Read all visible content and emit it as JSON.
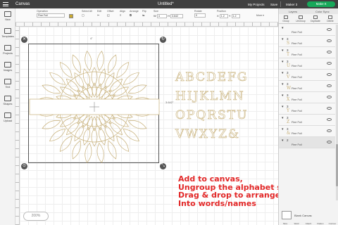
{
  "topbar": {
    "title": "Canvas",
    "document": "Untitled*",
    "my_projects": "My Projects",
    "save": "Save",
    "machine": "Maker 3",
    "make_button": "Make It"
  },
  "left_toolbar": [
    {
      "label": "New",
      "icon": "plus-icon"
    },
    {
      "label": "Templates",
      "icon": "shirt-icon"
    },
    {
      "label": "Projects",
      "icon": "folder-icon"
    },
    {
      "label": "Images",
      "icon": "image-icon"
    },
    {
      "label": "Text",
      "icon": "text-icon"
    },
    {
      "label": "Shapes",
      "icon": "shapes-icon"
    },
    {
      "label": "Upload",
      "icon": "upload-icon"
    }
  ],
  "editbar": {
    "operation_label": "Operation",
    "operation_value": "Fine Foil",
    "select_all": "Select All",
    "edit": "Edit",
    "offset": "Offset",
    "align": "Align",
    "arrange": "Arrange",
    "flip": "Flip",
    "size_label": "Size",
    "width": "4",
    "height": "3.642",
    "rotate_label": "Rotate",
    "rotate": "0",
    "position_label": "Position",
    "x": "1.2",
    "y": "1.2",
    "more": "More ▾",
    "foil_color": "#c9a830"
  },
  "canvas": {
    "width_dim": "4\"",
    "height_dim": "3.642\"",
    "letters_row1": "ABCDEFG",
    "letters_row2": "HIJKLMN",
    "letters_row3": "OPQRSTU",
    "letters_row4": "VWXYZ&",
    "instruction_lines": [
      "Add to canvas,",
      "Ungroup the alphabet set,",
      "Drag & drop to arrange",
      "Into words/names"
    ],
    "zoom": "200%",
    "motif_color": "#c7b079"
  },
  "panel": {
    "tab_layers": "Layers",
    "tab_color_sync": "Color Sync",
    "tools": [
      "Group",
      "UnGroup",
      "Duplicate",
      "Delete"
    ],
    "layers": [
      {
        "count": "",
        "name": "Fine Foil",
        "glyph": ""
      },
      {
        "count": "3",
        "name": "Fine Foil",
        "glyph": "S"
      },
      {
        "count": "3",
        "name": "Fine Foil",
        "glyph": "T"
      },
      {
        "count": "3",
        "name": "Fine Foil",
        "glyph": "U"
      },
      {
        "count": "3",
        "name": "Fine Foil",
        "glyph": "V"
      },
      {
        "count": "3",
        "name": "Fine Foil",
        "glyph": "W"
      },
      {
        "count": "3",
        "name": "Fine Foil",
        "glyph": "X"
      },
      {
        "count": "3",
        "name": "Fine Foil",
        "glyph": "Y"
      },
      {
        "count": "3",
        "name": "Fine Foil",
        "glyph": "Z"
      },
      {
        "count": "3",
        "name": "Fine Foil",
        "glyph": "&"
      },
      {
        "count": "2",
        "name": "Fine Foil",
        "glyph": ""
      }
    ],
    "blank_canvas": "Blank Canvas",
    "bottom_tools": [
      "Slice",
      "Weld",
      "Attach",
      "Flatten",
      "Contour"
    ]
  }
}
